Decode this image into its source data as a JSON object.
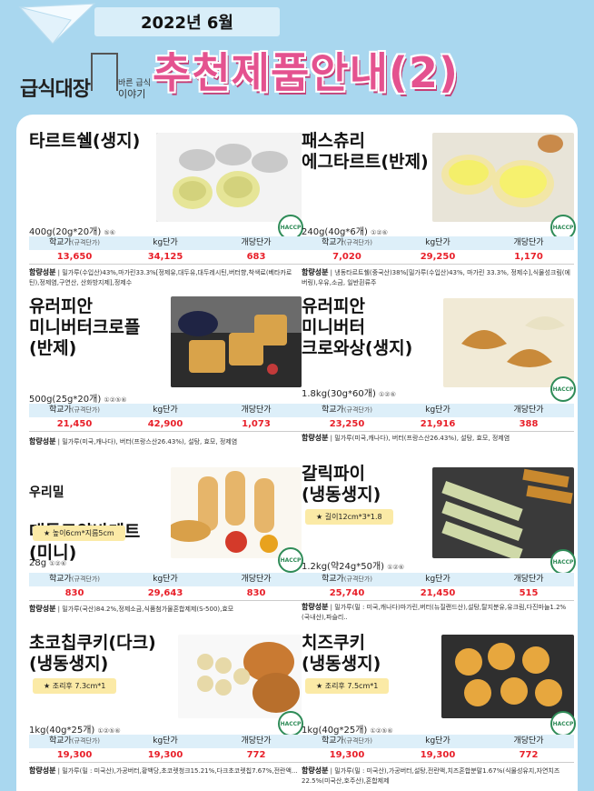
{
  "header": {
    "date": "2022년 6월",
    "brand_name": "급식대장",
    "brand_sub1": "바른 급식",
    "brand_sub2": "이야기",
    "title": "추천제품안내(2)"
  },
  "labels": {
    "school_price": "학교가",
    "school_price_note": "(규격단가)",
    "kg_price": "kg단가",
    "unit_price": "개당단가",
    "ingredients": "함량성분",
    "haccp": "HACCP"
  },
  "products": [
    {
      "name": "타르트쉘(생지)",
      "weight": "400g(20g*20개)",
      "weight_note": "⑤⑥",
      "school_price": "13,650",
      "kg_price": "34,125",
      "unit_price": "683",
      "ingredients": "밀가루(수입산)43%,마가린33.3%[정제유,대두유,대두레시틴,버터향,착색료(베타카로틴),정제염,구연산, 산화방지제],정제수"
    },
    {
      "name": "패스츄리\n에그타르트(반제)",
      "weight": "240g(40g*6개)",
      "weight_note": "①②⑥",
      "school_price": "7,020",
      "kg_price": "29,250",
      "unit_price": "1,170",
      "ingredients": "냉동타르트쉘(중국산)38%[밀가루(수입산)43%, 마가린 33.3%, 정제수],식물성크림(에버링),우유,소금, 일반흰류주"
    },
    {
      "name": "유러피안\n미니버터크로플\n(반제)",
      "weight": "500g(25g*20개)",
      "weight_note": "①②⑤⑥",
      "school_price": "21,450",
      "kg_price": "42,900",
      "unit_price": "1,073",
      "ingredients": "밀가루(미국,캐나다), 버터(프랑스산26.43%), 설탕, 효모, 정제염"
    },
    {
      "name": "유러피안\n미니버터\n크로와상(생지)",
      "weight": "1.8kg(30g*60개)",
      "weight_note": "①②⑥",
      "school_price": "23,250",
      "kg_price": "21,916",
      "unit_price": "388",
      "ingredients": "밀가루(미국,캐나다), 버터(프랑스산26.43%), 설탕, 효모, 정제염"
    },
    {
      "pre": "우리밀",
      "name": "대통모양바게트\n(미니)",
      "badge": "★ 높이6cm*지름5cm",
      "weight": "28g",
      "weight_note": "①②⑥",
      "school_price": "830",
      "kg_price": "29,643",
      "unit_price": "830",
      "ingredients": "밀가루(국산)84.2%,정제소금,식품첨가물혼합제제(S-500),효모"
    },
    {
      "name": "갈릭파이\n(냉동생지)",
      "badge": "★ 길이12cm*3*1.8",
      "weight": "1.2kg(약24g*50개)",
      "weight_note": "①②⑥",
      "school_price": "25,740",
      "kg_price": "21,450",
      "unit_price": "515",
      "ingredients": "밀가루(밀 : 미국,캐나다)마가린,버터(뉴질랜드산),설탕,탈지분유,유크림,다진마늘1.2%(국내산),파슬리.."
    },
    {
      "name": "초코칩쿠키(다크)\n(냉동생지)",
      "badge": "★ 조리후 7.3cm*1",
      "weight": "1kg(40g*25개)",
      "weight_note": "①②⑤⑥",
      "school_price": "19,300",
      "kg_price": "19,300",
      "unit_price": "772",
      "ingredients": "밀가루(밀 : 미국산),가공버터,황백당,초코렛청크15.21%,다크초코렛칩7.67%,전란액..."
    },
    {
      "name": "치즈쿠키\n(냉동생지)",
      "badge": "★ 조리후 7.5cm*1",
      "weight": "1kg(40g*25개)",
      "weight_note": "①②⑤⑥",
      "school_price": "19,300",
      "kg_price": "19,300",
      "unit_price": "772",
      "ingredients": "밀가루(밀 : 미국산),가공버터,설탕,전란액,치즈혼합분말1.67%(식물성유지,자연치즈22.5%(미국산,호주산),혼합제제"
    }
  ]
}
